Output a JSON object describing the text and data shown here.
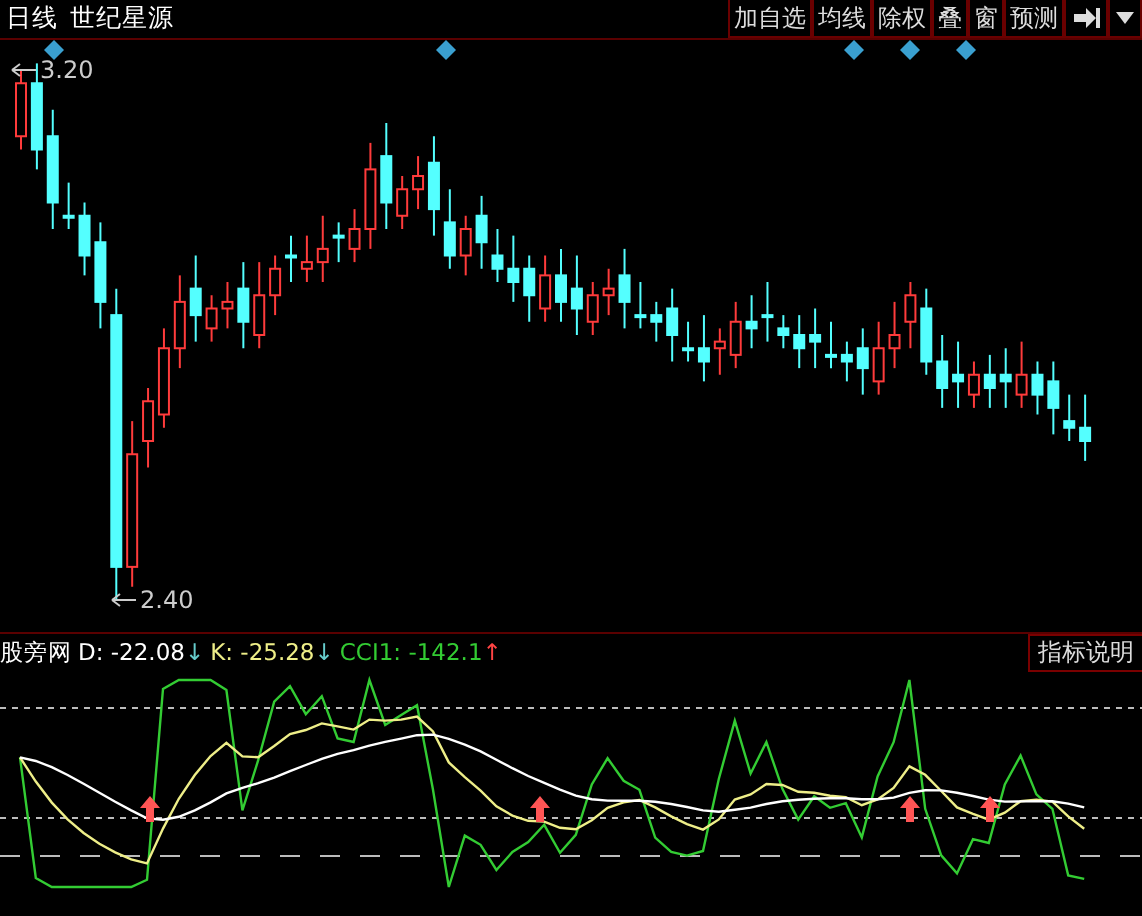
{
  "top_bar": {
    "period": "日线",
    "stock_name": "世纪星源"
  },
  "toolbar": {
    "buttons": [
      "加自选",
      "均线",
      "除权",
      "叠",
      "窗",
      "预测"
    ]
  },
  "price_chart": {
    "high_label": "3.20",
    "low_label": "2.40"
  },
  "indicator": {
    "name": "股旁网",
    "legend": [
      {
        "label": "D: -22.08",
        "arrow": "↓",
        "rising": false,
        "color": "#ffffff"
      },
      {
        "label": "K: -25.28",
        "arrow": "↓",
        "rising": false,
        "color": "#eeee88"
      },
      {
        "label": "CCI1: -142.1",
        "arrow": "↑",
        "rising": true,
        "color": "#33cc33"
      }
    ],
    "help_button": "指标说明"
  }
}
